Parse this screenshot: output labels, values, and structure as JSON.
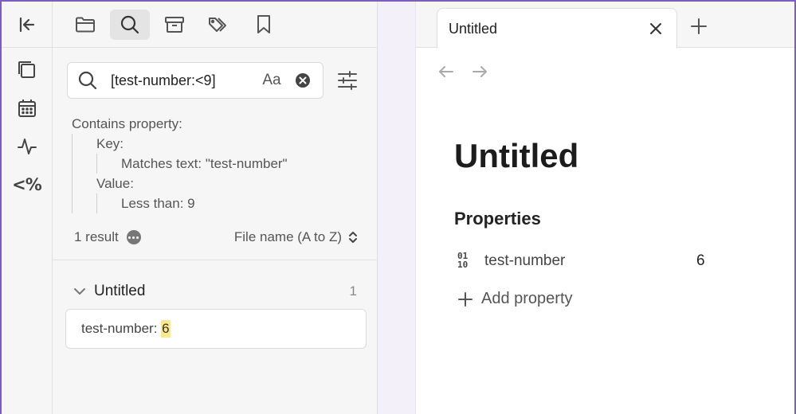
{
  "colors": {
    "accent": "#7a5fbf",
    "highlight": "#fde98a"
  },
  "ribbon": {
    "collapse_icon": "collapse-left-icon",
    "items": [
      {
        "name": "gallery-icon"
      },
      {
        "name": "calendar-icon"
      },
      {
        "name": "activity-icon"
      },
      {
        "name": "templater",
        "label": "<%"
      }
    ]
  },
  "sidebar": {
    "tabs": [
      {
        "name": "folder-icon"
      },
      {
        "name": "search-icon",
        "active": true
      },
      {
        "name": "archive-icon"
      },
      {
        "name": "tags-icon"
      },
      {
        "name": "bookmark-icon"
      }
    ],
    "search": {
      "query": "[test-number:<9]",
      "case_label": "Aa"
    },
    "explain": {
      "contains": "Contains property:",
      "key_label": "Key:",
      "key_match": "Matches text: \"test-number\"",
      "value_label": "Value:",
      "value_match": "Less than: 9"
    },
    "meta": {
      "result_count": "1 result",
      "sort_label": "File name (A to Z)"
    },
    "results": [
      {
        "file": "Untitled",
        "count": "1",
        "match_prefix": "test-number: ",
        "match_highlight": "6"
      }
    ]
  },
  "editor": {
    "tab_title": "Untitled",
    "note_title": "Untitled",
    "properties_heading": "Properties",
    "properties": [
      {
        "key": "test-number",
        "value": "6",
        "icon": "number-icon"
      }
    ],
    "add_property_label": "Add property"
  }
}
